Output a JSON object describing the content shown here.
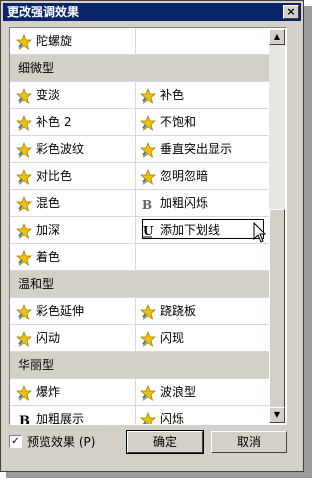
{
  "window": {
    "title": "更改强调效果",
    "close": "×"
  },
  "list": {
    "sections": [
      {
        "header": "",
        "rows": [
          [
            "陀螺旋",
            ""
          ]
        ]
      },
      {
        "header": "细微型",
        "rows": [
          [
            "变淡",
            "补色"
          ],
          [
            "补色 2",
            "不饱和"
          ],
          [
            "彩色波纹",
            "垂直突出显示"
          ],
          [
            "对比色",
            "忽明忽暗"
          ],
          [
            "混色",
            "加粗闪烁"
          ],
          [
            "加深",
            "添加下划线"
          ],
          [
            "着色",
            ""
          ]
        ]
      },
      {
        "header": "温和型",
        "rows": [
          [
            "彩色延伸",
            "跷跷板"
          ],
          [
            "闪动",
            "闪现"
          ]
        ]
      },
      {
        "header": "华丽型",
        "rows": [
          [
            "爆炸",
            "波浪型"
          ],
          [
            "加粗展示",
            "闪烁"
          ]
        ]
      }
    ],
    "selected": "添加下划线"
  },
  "footer": {
    "preview_label": "预览效果 (P)",
    "preview_checked": "✓",
    "ok_label": "确定",
    "cancel_label": "取消"
  }
}
